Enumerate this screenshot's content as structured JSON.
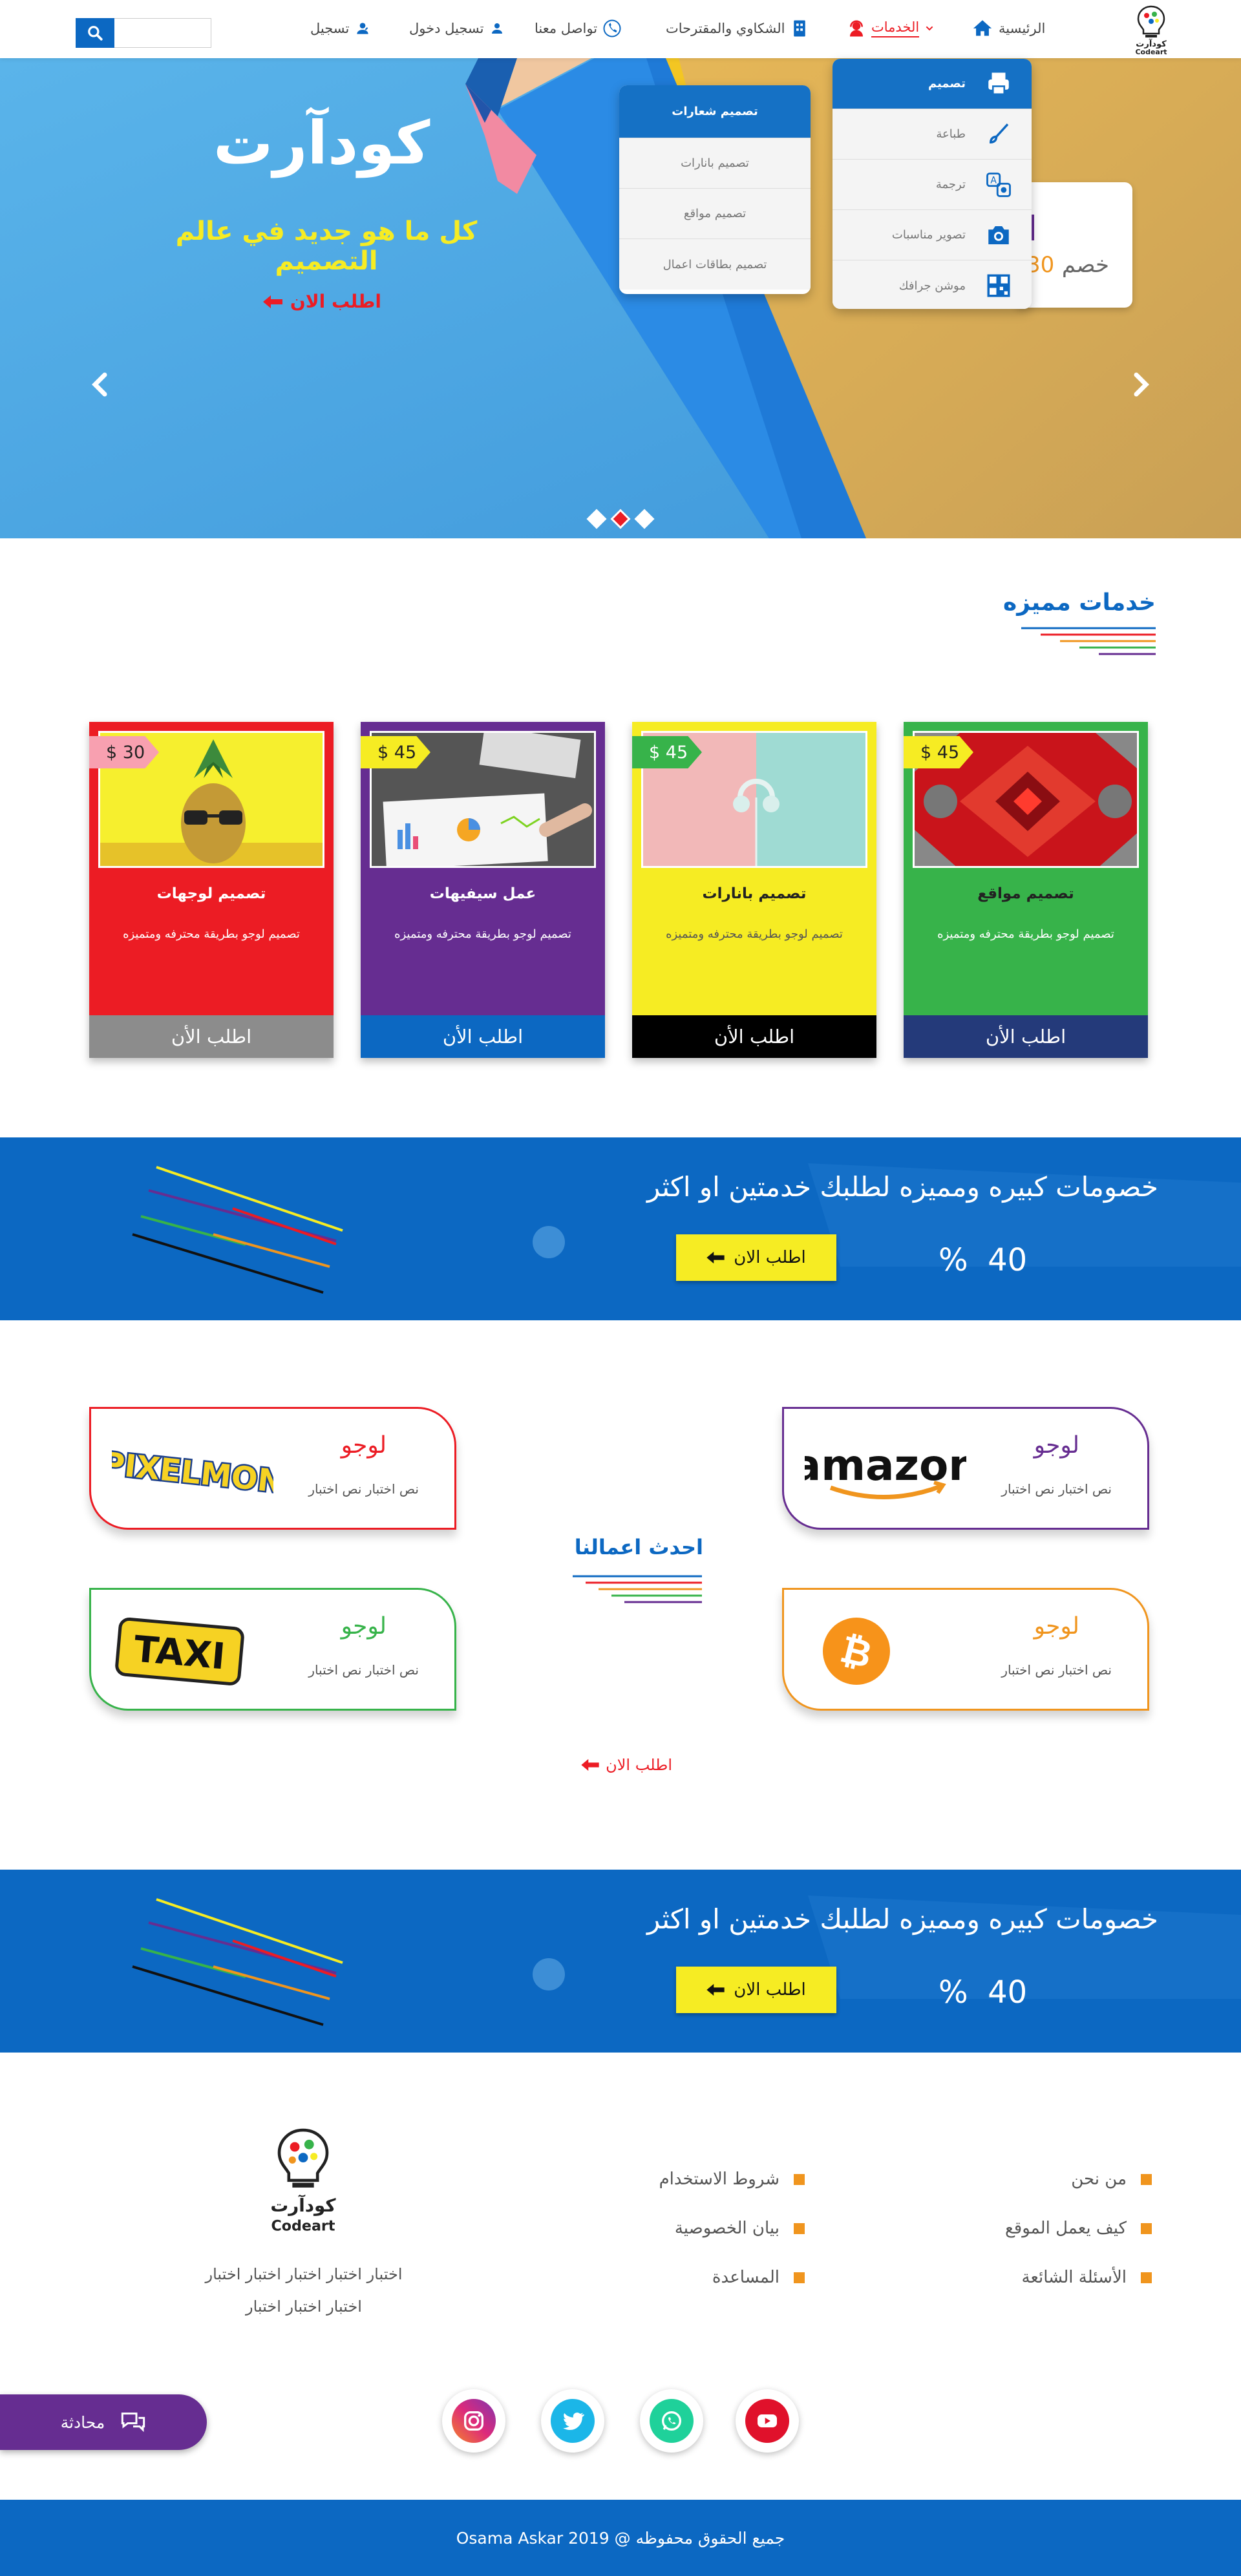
{
  "header": {
    "logo_text_ar": "كودآرت",
    "logo_text_en": "Codeart",
    "nav": {
      "home": "الرئيسية",
      "services": "الخدمات",
      "complaints": "الشكاوي والمقترحات",
      "contact": "تواصل معنا",
      "login": "تسجيل دخول",
      "register": "تسجيل"
    },
    "search": {
      "placeholder": ""
    }
  },
  "hero": {
    "title": "كودآرت",
    "subtitle": "كل ما هو جديد في عالم التصميم",
    "cta": "اطلب الان",
    "promo_label": "خصم",
    "promo_value": "30",
    "slide_count": 3,
    "active_slide": 2
  },
  "services_menu": {
    "items": [
      "تصميم",
      "طباعة",
      "ترجمة",
      "تصوير مناسبات",
      "موشن جرافك"
    ],
    "icons": [
      "printer-icon",
      "brush-icon",
      "translate-icon",
      "camera-icon",
      "qr-icon"
    ],
    "active_index": 0
  },
  "design_submenu": {
    "items": [
      "تصميم شعارات",
      "تصميم بانارات",
      "تصميم مواقع",
      "تصميم بطاقات اعمال"
    ],
    "active_index": 0
  },
  "featured": {
    "heading": "خدمات  مميزه",
    "cards": [
      {
        "title": "تصميم مواقع",
        "desc": "تصميم لوجو  بطريقة محترفه ومتميزه",
        "price": "$ 45",
        "button": "اطلب الأن",
        "color": "#37b34a",
        "button_color": "#243a7a",
        "price_color": "#f6ec23"
      },
      {
        "title": "تصميم بانارات",
        "desc": "تصميم لوجو  بطريقة محترفه ومتميزه",
        "price": "$ 45",
        "button": "اطلب الأن",
        "color": "#f6ec23",
        "button_color": "#000000",
        "price_color": "#37b34a"
      },
      {
        "title": "عمل سيفيهات",
        "desc": "تصميم لوجو  بطريقة محترفه ومتميزه",
        "price": "$ 45",
        "button": "اطلب الأن",
        "color": "#662d91",
        "button_color": "#0c68c2",
        "price_color": "#f6ec23"
      },
      {
        "title": "تصميم لوجهات",
        "desc": "تصميم لوجو  بطريقة محترفه ومتميزه",
        "price": "$ 30",
        "button": "اطلب الأن",
        "color": "#ec1c24",
        "button_color": "#8c8c8c",
        "price_color": "#f8a0b0"
      }
    ]
  },
  "discount_band": {
    "text": "خصومات كبيره ومميزه لطلبك خدمتين او اكثر",
    "cta": "اطلب الان",
    "percent": "40",
    "percent_sign": "%"
  },
  "works": {
    "heading": "احدث اعمالنا",
    "items": [
      {
        "title": "لوجو",
        "desc": "نص اختبار نص اختبار",
        "logo": "amazon-logo",
        "logo_text": "amazon",
        "border": "#662d91",
        "title_color": "#662d91"
      },
      {
        "title": "لوجو",
        "desc": "نص اختبار نص اختبار",
        "logo": "pixelmon-logo",
        "logo_text": "PIXELMON",
        "border": "#ec1c24",
        "title_color": "#ec1c24"
      },
      {
        "title": "لوجو",
        "desc": "نص اختبار نص اختبار",
        "logo": "bitcoin-logo",
        "logo_text": "",
        "border": "#f0951e",
        "title_color": "#f0951e"
      },
      {
        "title": "لوجو",
        "desc": "نص اختبار نص اختبار",
        "logo": "taxi-logo",
        "logo_text": "TAXI",
        "border": "#37b34a",
        "title_color": "#37b34a"
      }
    ],
    "cta": "اطلب الان"
  },
  "footer": {
    "links_col1": [
      "من نحن",
      "كيف يعمل الموقع",
      "الأسئلة الشائعة"
    ],
    "links_col2": [
      "شروط الاستخدام",
      "بيان الخصوصية",
      "المساعدة"
    ],
    "about_line1": "اختبار اختبار اختبار اختبار اختبار",
    "about_line2": "اختبار اختبار اختبار",
    "social": [
      "youtube-icon",
      "whatsapp-icon",
      "twitter-icon",
      "instagram-icon"
    ],
    "chat": "محادثة",
    "copyright": "جميع الحقوق محفوظه @  2019  Osama Askar"
  },
  "colors": {
    "primary_blue": "#0c68c2",
    "red": "#ec1c24",
    "yellow": "#f6ec23",
    "green": "#37b34a",
    "purple": "#662d91",
    "orange": "#f0951e"
  }
}
